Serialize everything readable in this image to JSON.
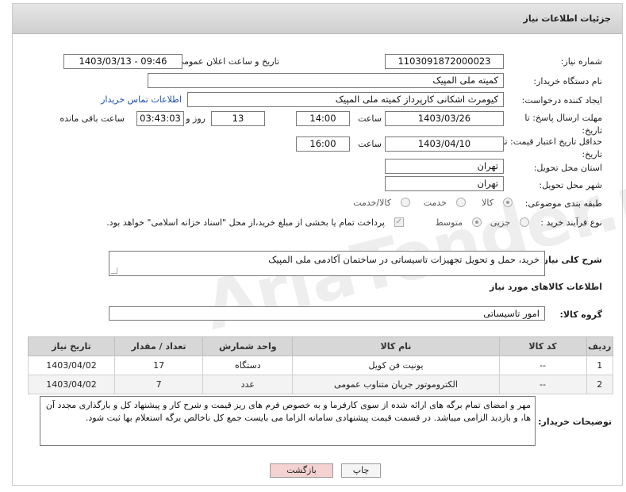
{
  "header": {
    "title": "جزئیات اطلاعات نیاز"
  },
  "fields": {
    "need_number": {
      "label": "شماره نیاز:",
      "value": "1103091872000023"
    },
    "announce": {
      "label": "تاریخ و ساعت اعلان عمومی:",
      "value": "1403/03/13 - 09:46"
    },
    "buyer_org": {
      "label": "نام دستگاه خریدار:",
      "value": "کمیته ملی المپیک"
    },
    "requester": {
      "label": "ایجاد کننده درخواست:",
      "value": "کیومرث اشکانی کارپرداز کمیته ملی المپیک",
      "contact_link": "اطلاعات تماس خریدار"
    },
    "deadline": {
      "label": "مهلت ارسال پاسخ: تا تاریخ:",
      "date": "1403/03/26",
      "time_label": "ساعت",
      "time": "14:00",
      "days": "13",
      "days_label": "روز و",
      "remaining": "03:43:03",
      "remaining_label": "ساعت باقی مانده"
    },
    "validity": {
      "label": "حداقل تاریخ اعتبار قیمت: تا تاریخ:",
      "date": "1403/04/10",
      "time_label": "ساعت",
      "time": "16:00"
    },
    "province": {
      "label": "استان محل تحویل:",
      "value": "تهران"
    },
    "city": {
      "label": "شهر محل تحویل:",
      "value": "تهران"
    },
    "category": {
      "label": "طبقه بندی موضوعی:",
      "options": [
        "کالا",
        "خدمت",
        "کالا/خدمت"
      ]
    },
    "process": {
      "label": "نوع فرآیند خرید :",
      "options": [
        "جزیی",
        "متوسط"
      ],
      "note": "پرداخت تمام یا بخشی از مبلغ خرید،از محل \"اسناد خزانه اسلامی\" خواهد بود."
    },
    "description": {
      "label": "شرح کلی نیاز:",
      "value": "خرید، حمل و تحویل تجهیزات تاسیساتی در ساختمان آکادمی ملی المپیک"
    }
  },
  "items_section": {
    "title": "اطلاعات کالاهای مورد نیاز",
    "group_label": "گروه کالا:",
    "group_value": "امور تاسیساتی"
  },
  "table": {
    "headers": [
      "ردیف",
      "کد کالا",
      "نام کالا",
      "واحد شمارش",
      "تعداد / مقدار",
      "تاریخ نیاز"
    ],
    "rows": [
      [
        "1",
        "--",
        "یونیت فن کویل",
        "دستگاه",
        "17",
        "1403/04/02"
      ],
      [
        "2",
        "--",
        "الکتروموتور جریان متناوب عمومی",
        "عدد",
        "7",
        "1403/04/02"
      ]
    ]
  },
  "buyer_notes": {
    "label": "توضیحات خریدار:",
    "value": "مهر و امضای تمام برگه های ارائه شده از سوی کارفرما و به خصوص فرم های ریز قیمت و شرح کار و پیشنهاد کل و بارگذاری مجدد آن ها، و بازدید الزامی میباشد. در قسمت قیمت پیشنهادی سامانه الزاما می بایست جمع کل ناخالص برگه استعلام بها ثبت شود."
  },
  "buttons": {
    "print": "چاپ",
    "back": "بازگشت"
  },
  "watermark": "AriaTender.net",
  "colors": {
    "link": "#1a4fb0",
    "back_button_bg": "#f4d2d2",
    "header_bg": "#d9d9d9"
  }
}
